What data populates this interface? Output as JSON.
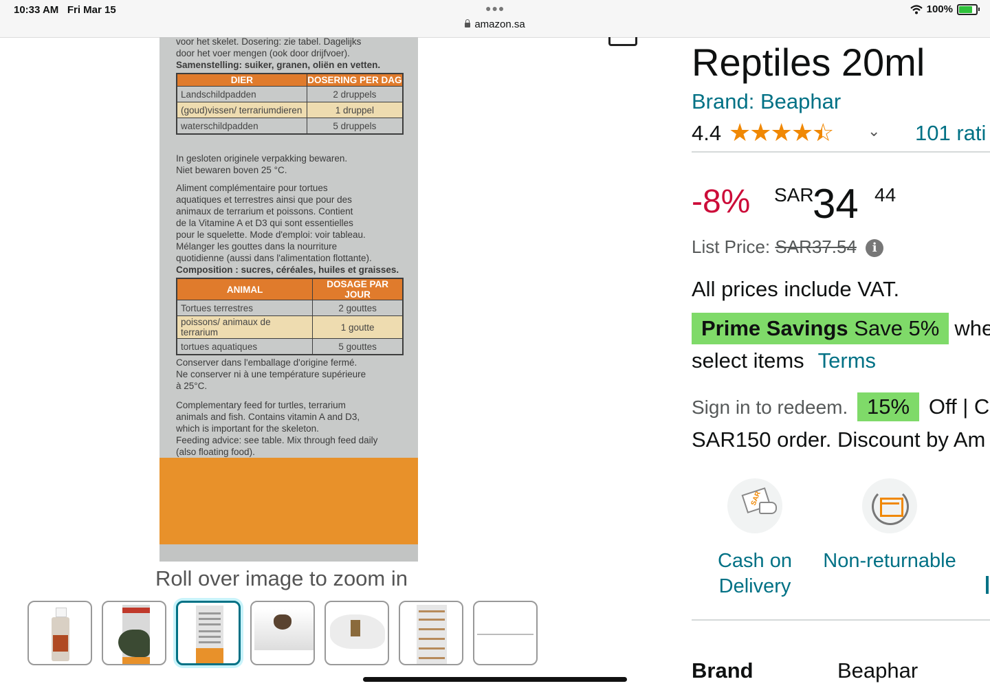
{
  "status_bar": {
    "time": "10:33 AM",
    "date": "Fri Mar 15",
    "url": "amazon.sa",
    "battery": "100%"
  },
  "gallery": {
    "package_text": {
      "nl_top": [
        "voor het skelet. Dosering: zie tabel. Dagelijks",
        "door het voer mengen (ook door drijfvoer).",
        "Samenstelling: suiker, granen, oliën en vetten."
      ],
      "nl_table": {
        "headers": [
          "DIER",
          "DOSERING PER DAG"
        ],
        "rows": [
          [
            "Landschildpadden",
            "2 druppels"
          ],
          [
            "(goud)vissen/ terrariumdieren",
            "1 druppel"
          ],
          [
            "waterschildpadden",
            "5 druppels"
          ]
        ]
      },
      "nl_storage": [
        "In gesloten originele verpakking bewaren.",
        "Niet bewaren boven 25 °C."
      ],
      "fr_text": [
        "Aliment complémentaire pour tortues",
        "aquatiques et terrestres ainsi que pour des",
        "animaux de terrarium et poissons. Contient",
        "de la Vitamine A et D3 qui sont essentielles",
        "pour le squelette. Mode d'emploi: voir tableau.",
        "Mélanger les gouttes dans la nourriture",
        "quotidienne (aussi dans l'alimentation flottante).",
        "Composition : sucres, céréales, huiles et graisses."
      ],
      "fr_table": {
        "headers": [
          "ANIMAL",
          "DOSAGE PAR JOUR"
        ],
        "rows": [
          [
            "Tortues terrestres",
            "2 gouttes"
          ],
          [
            "poissons/ animaux de terrarium",
            "1 goutte"
          ],
          [
            "tortues aquatiques",
            "5 gouttes"
          ]
        ]
      },
      "fr_storage": [
        "Conserver dans l'emballage d'origine fermé.",
        "Ne conserver ni à une température supérieure",
        "à 25°C."
      ],
      "en_text": [
        "Complementary feed for turtles, terrarium",
        "animals and fish. Contains vitamin A and D3,",
        "which is important for the skeleton.",
        "Feeding advice: see table. Mix through feed daily",
        "(also floating food)."
      ]
    },
    "zoom_hint": "Roll over image to zoom in",
    "selected_thumbnail": 3,
    "thumbnail_count": 7
  },
  "product": {
    "title": "Reptiles 20ml",
    "brand_link": "Brand: Beaphar",
    "rating": "4.4",
    "stars_value": 4.4,
    "rating_count": "101 rati",
    "discount": "-8%",
    "currency": "SAR",
    "price_whole": "34",
    "price_fraction": "44",
    "list_price_label": "List Price:",
    "list_price_value": "SAR37.54",
    "vat_note": "All prices include VAT.",
    "prime_label": "Prime Savings",
    "prime_save": "Save 5%",
    "prime_tail": "whe",
    "prime_line2": "select items",
    "terms_link": "Terms",
    "coupon_signin": "Sign in to redeem.",
    "coupon_percent": "15%",
    "coupon_rest": "Off | C",
    "coupon_line2": "SAR150 order. Discount by Am",
    "features": [
      {
        "label": "Cash on Delivery",
        "icon": "cash-on-delivery-icon"
      },
      {
        "label": "Non-returnable",
        "icon": "non-returnable-icon"
      }
    ],
    "spec": {
      "key": "Brand",
      "value": "Beaphar"
    }
  },
  "colors": {
    "link": "#007185",
    "discount": "#cc0c39",
    "star": "#f08804",
    "prime_badge": "#7fda69",
    "package_orange": "#e8912a"
  }
}
